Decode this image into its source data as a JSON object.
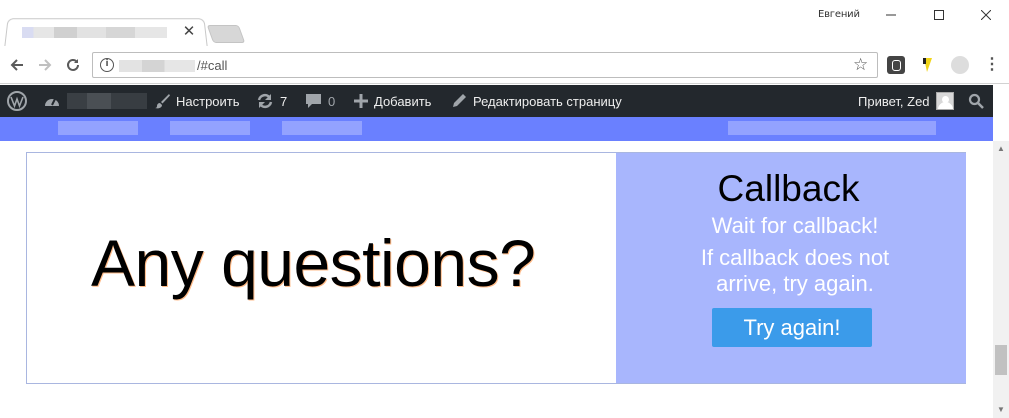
{
  "window": {
    "username": "Евгений"
  },
  "toolbar": {
    "url_suffix": "/#call"
  },
  "adminbar": {
    "customize_label": "Настроить",
    "updates_count": "7",
    "comments_count": "0",
    "add_label": "Добавить",
    "edit_label": "Редактировать страницу",
    "greeting": "Привет, Zed"
  },
  "main": {
    "questions_heading": "Any questions?",
    "callback": {
      "title": "Callback",
      "subtitle": "Wait for callback!",
      "info": "If callback does not arrive, try again.",
      "button_label": "Try again!"
    }
  },
  "colors": {
    "adminbar_bg": "#23282d",
    "sitenav_bg": "#6a80ff",
    "callback_panel_bg": "#a8b6fd",
    "button_bg": "#3b9bea"
  },
  "icons": {
    "wordpress": "wordpress-logo-icon",
    "dashboard": "dashboard-icon",
    "customize": "paintbrush-icon",
    "updates": "refresh-icon",
    "comments": "comment-bubble-icon",
    "add": "plus-icon",
    "edit": "pencil-icon",
    "search": "search-icon"
  }
}
